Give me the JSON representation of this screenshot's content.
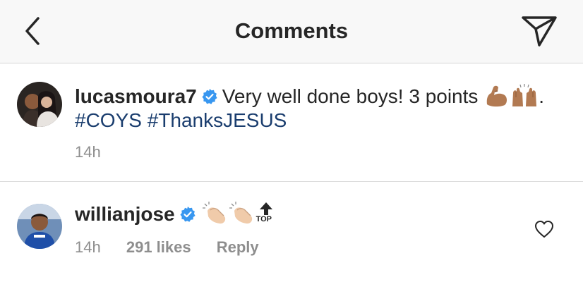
{
  "header": {
    "title": "Comments",
    "back_icon": "chevron-left-icon",
    "send_icon": "paper-plane-icon"
  },
  "caption": {
    "username": "lucasmoura7",
    "text": "Very well done boys! 3 points",
    "emojis_after_text": [
      "flexed-biceps-emoji",
      "raising-hands-emoji"
    ],
    "trailing_punct": ".",
    "hashtags": [
      "#COYS",
      "#ThanksJESUS"
    ],
    "time": "14h"
  },
  "comment": {
    "username": "willianjose",
    "emojis": [
      "clapping-hands-emoji",
      "clapping-hands-emoji",
      "top-arrow-emoji"
    ],
    "top_label": "TOP",
    "time": "14h",
    "likes": "291 likes",
    "reply": "Reply"
  },
  "colors": {
    "header_bg": "#f8f8f8",
    "text": "#262626",
    "muted": "#8e8e8e",
    "hashtag": "#1a3d6e",
    "verified": "#3897f0"
  }
}
